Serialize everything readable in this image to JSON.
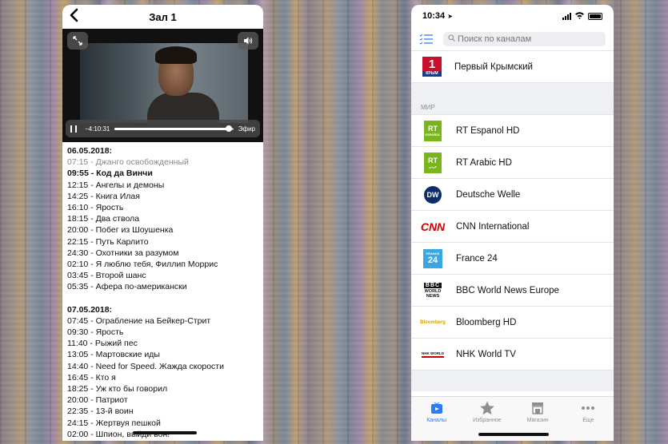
{
  "left": {
    "header": {
      "back_icon": "chevron-left-icon",
      "title": "Зал 1"
    },
    "video": {
      "time_remaining": "−4:10:31",
      "live_label": "Эфир",
      "progress": 0.96
    },
    "schedule": [
      {
        "date": "06.05.2018:",
        "items": [
          {
            "text": "07:15 - Джанго освобожденный",
            "state": "past"
          },
          {
            "text": "09:55 - Код да Винчи",
            "state": "now"
          },
          {
            "text": "12:15 - Ангелы и демоны",
            "state": "future"
          },
          {
            "text": "14:25 - Книга Илая",
            "state": "future"
          },
          {
            "text": "16:10 - Ярость",
            "state": "future"
          },
          {
            "text": "18:15 - Два ствола",
            "state": "future"
          },
          {
            "text": "20:00 - Побег из Шоушенка",
            "state": "future"
          },
          {
            "text": "22:15 - Путь Карлито",
            "state": "future"
          },
          {
            "text": "24:30 - Охотники за разумом",
            "state": "future"
          },
          {
            "text": "02:10 - Я люблю тебя, Филлип Моррис",
            "state": "future"
          },
          {
            "text": "03:45 - Второй шанс",
            "state": "future"
          },
          {
            "text": "05:35 - Афера по-американски",
            "state": "future"
          }
        ]
      },
      {
        "date": "07.05.2018:",
        "items": [
          {
            "text": "07:45 - Ограбление на Бейкер-Стрит",
            "state": "future"
          },
          {
            "text": "09:30 - Ярость",
            "state": "future"
          },
          {
            "text": "11:40 - Рыжий пес",
            "state": "future"
          },
          {
            "text": "13:05 - Мартовские иды",
            "state": "future"
          },
          {
            "text": "14:40 - Need for Speed. Жажда скорости",
            "state": "future"
          },
          {
            "text": "16:45 - Кто я",
            "state": "future"
          },
          {
            "text": "18:25 - Уж кто бы говорил",
            "state": "future"
          },
          {
            "text": "20:00 - Патриот",
            "state": "future"
          },
          {
            "text": "22:35 - 13-й воин",
            "state": "future"
          },
          {
            "text": "24:15 - Жертвуя пешкой",
            "state": "future"
          },
          {
            "text": "02:00 - Шпион, выйди вон!",
            "state": "future"
          }
        ]
      }
    ]
  },
  "right": {
    "status": {
      "time": "10:34"
    },
    "search": {
      "placeholder": "Поиск по каналам"
    },
    "top_channel": {
      "name": "Первый Крымский",
      "logo_text": "1",
      "logo_sub": "КРЫМ"
    },
    "section": "МИР",
    "channels": [
      {
        "name": "RT Espanol HD",
        "logo": "rt",
        "logo_text": "RT",
        "logo_sub": "ESPAÑOL"
      },
      {
        "name": "RT Arabic HD",
        "logo": "rt",
        "logo_text": "RT",
        "logo_sub": "عربي"
      },
      {
        "name": "Deutsche Welle",
        "logo": "dw",
        "logo_text": "DW"
      },
      {
        "name": "CNN International",
        "logo": "cnn",
        "logo_text": "CNN"
      },
      {
        "name": "France 24",
        "logo": "f24",
        "logo_text": "24",
        "logo_sub": "FRANCE"
      },
      {
        "name": "BBC World News Europe",
        "logo": "bbc",
        "logo_text": "BBC",
        "logo_sub": "WORLD NEWS"
      },
      {
        "name": "Bloomberg HD",
        "logo": "bloom",
        "logo_text": "Bloomberg"
      },
      {
        "name": "NHK World TV",
        "logo": "nhk",
        "logo_text": "NHK WORLD"
      }
    ],
    "tabs": [
      {
        "label": "Каналы",
        "icon": "tv-icon",
        "active": true
      },
      {
        "label": "Избранное",
        "icon": "star-icon",
        "active": false
      },
      {
        "label": "Магазин",
        "icon": "store-icon",
        "active": false
      },
      {
        "label": "Еще",
        "icon": "more-icon",
        "active": false
      }
    ],
    "colors": {
      "accent": "#2f7bf5",
      "rt_green": "#7ab51d",
      "cnn_red": "#cc0000",
      "f24_blue": "#3aa7e0"
    }
  }
}
